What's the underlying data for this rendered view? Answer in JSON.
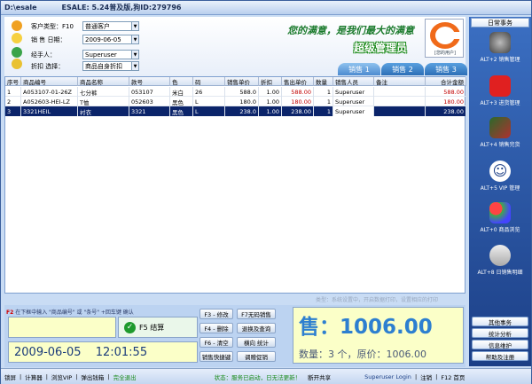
{
  "window": {
    "app": "D:\\esale",
    "version": "ESALE: 5.24普及版,狗ID:279796"
  },
  "form": {
    "customer_type_label": "客户类型：F10",
    "customer_type_value": "普通客户",
    "sale_date_label": "销 售  日期：",
    "sale_date_value": "2009-06-05",
    "handler_label": "经手人：",
    "handler_value": "Superuser",
    "discount_label": "折扣  选择：",
    "discount_value": "商品自身折扣"
  },
  "slogan": "您的满意，是我们最大的满意",
  "role": "超级管理员",
  "logo_caption": "[您的用户]",
  "tabs": [
    "销售 1",
    "销售 2",
    "销售 3"
  ],
  "table": {
    "headers": [
      "序号",
      "商品编号",
      "商品名称",
      "款号",
      "色",
      "码",
      "销售单价",
      "折扣",
      "售出单价",
      "数量",
      "销售人员",
      "备注",
      "合计金额"
    ],
    "rows": [
      [
        "1",
        "A053107-01-26Z",
        "七分裤",
        "053107",
        "米白",
        "26",
        "588.0",
        "1.00",
        "588.00",
        "1",
        "Superuser",
        "",
        "588.00"
      ],
      [
        "2",
        "A052603-HEI-LZ",
        "T恤",
        "052603",
        "黑色",
        "L",
        "180.0",
        "1.00",
        "180.00",
        "1",
        "Superuser",
        "",
        "180.00"
      ],
      [
        "3",
        "3321HEIL",
        "衬衣",
        "3321",
        "黑色",
        "L",
        "238.0",
        "1.00",
        "238.00",
        "1",
        "Superuser",
        "",
        "238.00"
      ]
    ]
  },
  "hint_bar": "类型：系统设置中，开启数据打印，设置相应的打印",
  "tip": {
    "key": "F2",
    "text": "在下框中输入 \"商品编号\" 或 \"条号\" +回车键 确认"
  },
  "pay_button": "F5 结算",
  "datetime": {
    "date": "2009-06-05",
    "time": "12:01:55"
  },
  "function_buttons": [
    "F3 - 修改",
    "F4 - 删除",
    "F6 - 清空",
    "销售快捷键",
    "F7无码销售",
    "退换及查询",
    "横向 统计",
    "调赠促销"
  ],
  "total": {
    "label": "售：",
    "amount": "1006.00",
    "qty_line": "数量：3 个，原价：1006.00"
  },
  "statusbar": {
    "items": [
      "锁屏",
      "计算器",
      "浏览VIP",
      "弹出钱箱",
      "完全退出"
    ],
    "status": "状态：服务已启动，日无法更新！",
    "link": "断开共享",
    "user": "Superuser Login",
    "logout": "注销",
    "f12": "F12 首页"
  },
  "sidebar": {
    "title": "日常事务",
    "items": [
      {
        "label": "ALT+2 销售管理",
        "icon": "hat-icon"
      },
      {
        "label": "ALT+3 进货管理",
        "icon": "dice-icon"
      },
      {
        "label": "ALT+4 销售完货",
        "icon": "feather-icon"
      },
      {
        "label": "ALT+5 VIP 管理",
        "icon": "person-icon"
      },
      {
        "label": "ALT+0 商品浏览",
        "icon": "balls-icon"
      },
      {
        "label": "ALT+8 日销售明细",
        "icon": "pin-icon"
      }
    ],
    "bottom_buttons": [
      "其他事务",
      "统计分析",
      "信息维护",
      "帮助及注册"
    ]
  },
  "colors": {
    "accent": "#1c3f86",
    "selected_row": "#0b246a",
    "total_text": "#2d7fd0"
  }
}
